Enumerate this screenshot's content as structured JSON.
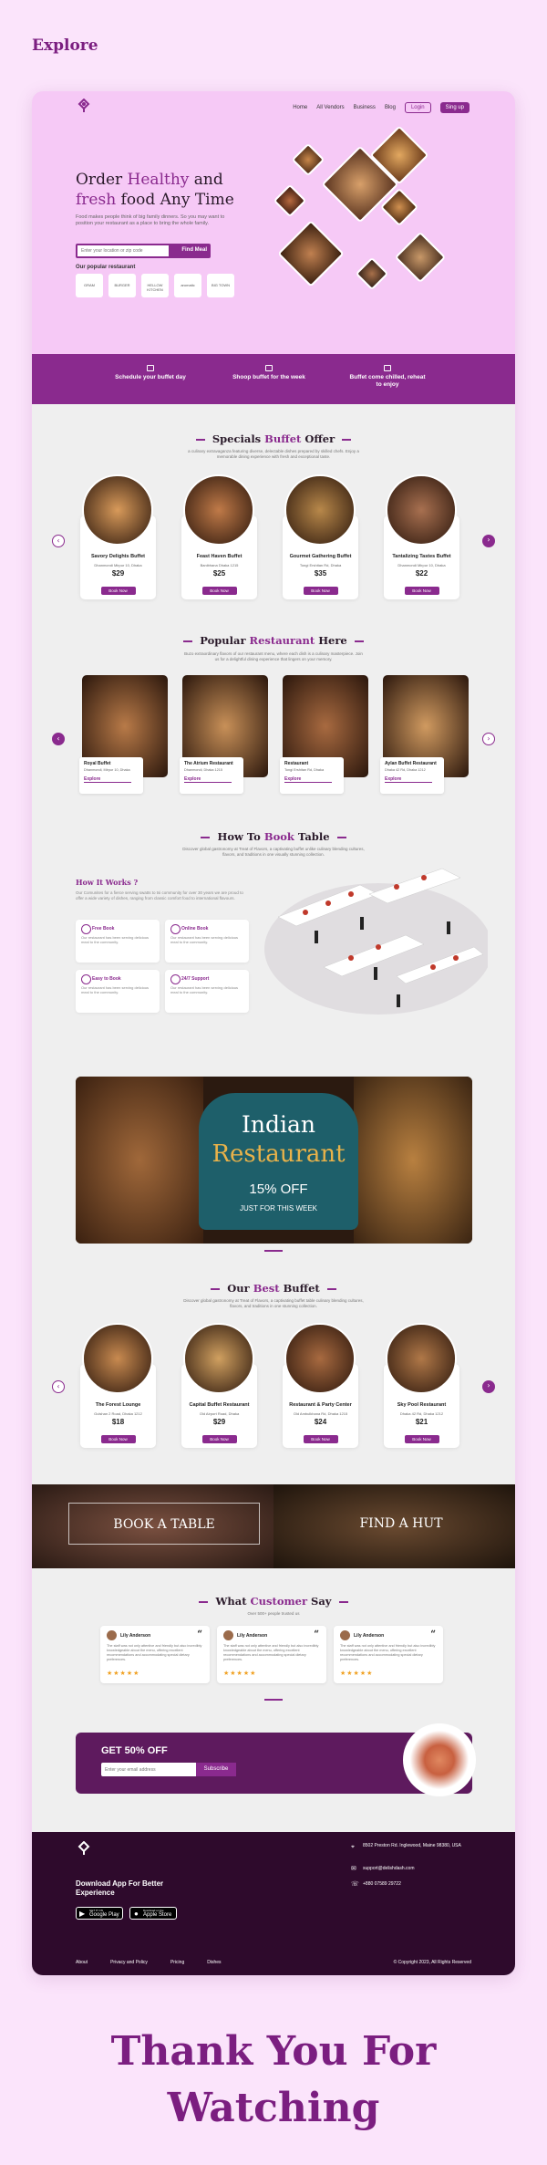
{
  "page_title": "Explore",
  "nav": {
    "items": [
      "Home",
      "All Vendors",
      "Business",
      "Blog"
    ],
    "login": "Login",
    "signup": "Sing up"
  },
  "hero": {
    "h_1": "Order ",
    "h_2": "Healthy",
    "h_3": " and",
    "h_4": "fresh",
    "h_5": " food Any Time",
    "desc": "Food makes people think of big family dinners. So you may want to position your restaurant as a place to bring the whole family.",
    "search_placeholder": "Enter your location or zip code",
    "search_btn": "Find Meal",
    "popular_label": "Our popular restaurant",
    "brands": [
      "GRAM",
      "BURGER",
      "HELLOW KITCHEN",
      "aromatic",
      "BIG TOWN"
    ]
  },
  "band": {
    "items": [
      "Schedule your buffet day",
      "Shoop  buffet for the week",
      "Buffet come chilled, reheat to enjoy"
    ]
  },
  "specials": {
    "title_1": "Specials ",
    "title_2": "Buffet",
    "title_3": " Offer",
    "sub": "a culinary extravaganza featuring diverse, delectable dishes prepared by skilled chefs. Enjoy a memorable dining experience with fresh and exceptional taste.",
    "cards": [
      {
        "name": "Savory Delights Buffet",
        "addr": "Dhanmondi Mirpur 10, Dhaka",
        "price": "$29"
      },
      {
        "name": "Feast Haven Buffet",
        "addr": "Banibhana Dhaka 1215",
        "price": "$25"
      },
      {
        "name": "Gourmet Gathering Buffet",
        "addr": "Tongi Ershitan Rd, Dhaka",
        "price": "$35"
      },
      {
        "name": "Tantalizing Tastes Buffet",
        "addr": "Dhanmondi Mirpur 10, Dhaka",
        "price": "$22"
      }
    ],
    "btn": "Book Now"
  },
  "popular": {
    "title_1": "Popular ",
    "title_2": "Restaurant",
    "title_3": " Here",
    "sub": "Buzo extraordinary flavors of our restaurant menu, where each dish is a culinary masterpiece. Join us for a delightful dining experience that lingers on your memory.",
    "cards": [
      {
        "name": "Royal Buffet",
        "addr": "Dhanmondi, Mirpur 10, Dhaka"
      },
      {
        "name": "The Atrium Restaurant",
        "addr": "Dhanmondi, Dhaka 1215"
      },
      {
        "name": "Restaurant",
        "addr": "Tongi Ershitan Rd, Dhaka"
      },
      {
        "name": "Aylan Buffet Restaurant",
        "addr": "Dhaka 42 Rd, Dhaka 1212"
      }
    ],
    "btn": "Explore"
  },
  "how": {
    "title_1": "How To ",
    "title_2": "Book",
    "title_3": " Table",
    "sub": "Discover global gastronomy at Treat of Flavors, a captivating buffet unlike culinary blending cultures, flavors, and traditions in one visually stunning collection.",
    "heading": "How It Works  ?",
    "desc": "Our Comunites for a fierce serving swatts to tsi community for over 30 years we are proud to offer a wide variety of dishes, ranging from classic comfort food to international flavours.",
    "items": [
      {
        "t": "Free Book",
        "d": "Our restaurant has been serving delicious meal to the community."
      },
      {
        "t": "Online Book",
        "d": "Our restaurant has been serving delicious meal to the community."
      },
      {
        "t": "Easy to Book",
        "d": "Our restaurant has been serving delicious meal to the community."
      },
      {
        "t": "24/7 Support",
        "d": "Our restaurant has been serving delicious meal to the community."
      }
    ]
  },
  "indian": {
    "l1": "Indian",
    "l2": "Restaurant",
    "l3": "15% OFF",
    "l4": "JUST FOR THIS WEEK"
  },
  "best": {
    "title_1": "Our ",
    "title_2": "Best",
    "title_3": " Buffet",
    "sub": "Discover global gastronomy at Treat of Flavors, a captivating buffet table culinary blending cultures, flavors, and traditions in one stunning collection.",
    "cards": [
      {
        "name": "The Forest Lounge",
        "addr": "Gulshan 2 Road, Dhaka 1212",
        "price": "$18"
      },
      {
        "name": "Capital Buffet Restaurant",
        "addr": "Old Airport Road, Dhaka",
        "price": "$29"
      },
      {
        "name": "Restaurant & Party Center",
        "addr": "Old Ambulkhana Rd, Dhaka 1215",
        "price": "$24"
      },
      {
        "name": "Sky Pool Restaurant",
        "addr": "Dhaka 42 Rd, Dhaka 1212",
        "price": "$21"
      }
    ],
    "btn": "Book Now"
  },
  "bookfind": {
    "book": "BOOK A TABLE",
    "find": "FIND A HUT"
  },
  "reviews": {
    "title_1": "What ",
    "title_2": "Customer",
    "title_3": " Say",
    "sub": "Over 500+ people trusted us",
    "cards": [
      {
        "name": "Lily Anderson",
        "text": "The staff was not only attentive and friendly but also incredibly knowledgeable about the menu, offering excellent recommendations and accommodating special dietary preferences."
      },
      {
        "name": "Lily Anderson",
        "text": "The staff was not only attentive and friendly but also incredibly knowledgeable about the menu, offering excellent recommendations and accommodating special dietary preferences."
      },
      {
        "name": "Lily Anderson",
        "text": "The staff was not only attentive and friendly but also incredibly knowledgeable about the menu, offering excellent recommendations and accommodating special dietary preferences."
      }
    ],
    "stars": "★★★★★"
  },
  "subscribe": {
    "title": "GET 50% OFF",
    "placeholder": "Enter your email address",
    "btn": "Subscribe"
  },
  "footer": {
    "app": "Download App For Better Experience",
    "gp_small": "GET IT ON",
    "gp": "Google Play",
    "as_small": "Download on the",
    "as": "Apple Store",
    "address": "8502 Preston Rd. Inglewood, Maine 98380, USA",
    "email": "support@delishdash.com",
    "phone": "+880 07589 29722",
    "links": [
      "About",
      "Privacy and Policy",
      "Pricing",
      "Dishes"
    ],
    "copy": "© Copyright 2023, All Rights Reserved"
  },
  "thanks": {
    "l1": "Thank You For",
    "l2": "Watching"
  },
  "colors": {
    "brand": "#8a2a8e",
    "hero_bg": "#f6c9f6",
    "footer_bg": "#2e0a2c"
  }
}
